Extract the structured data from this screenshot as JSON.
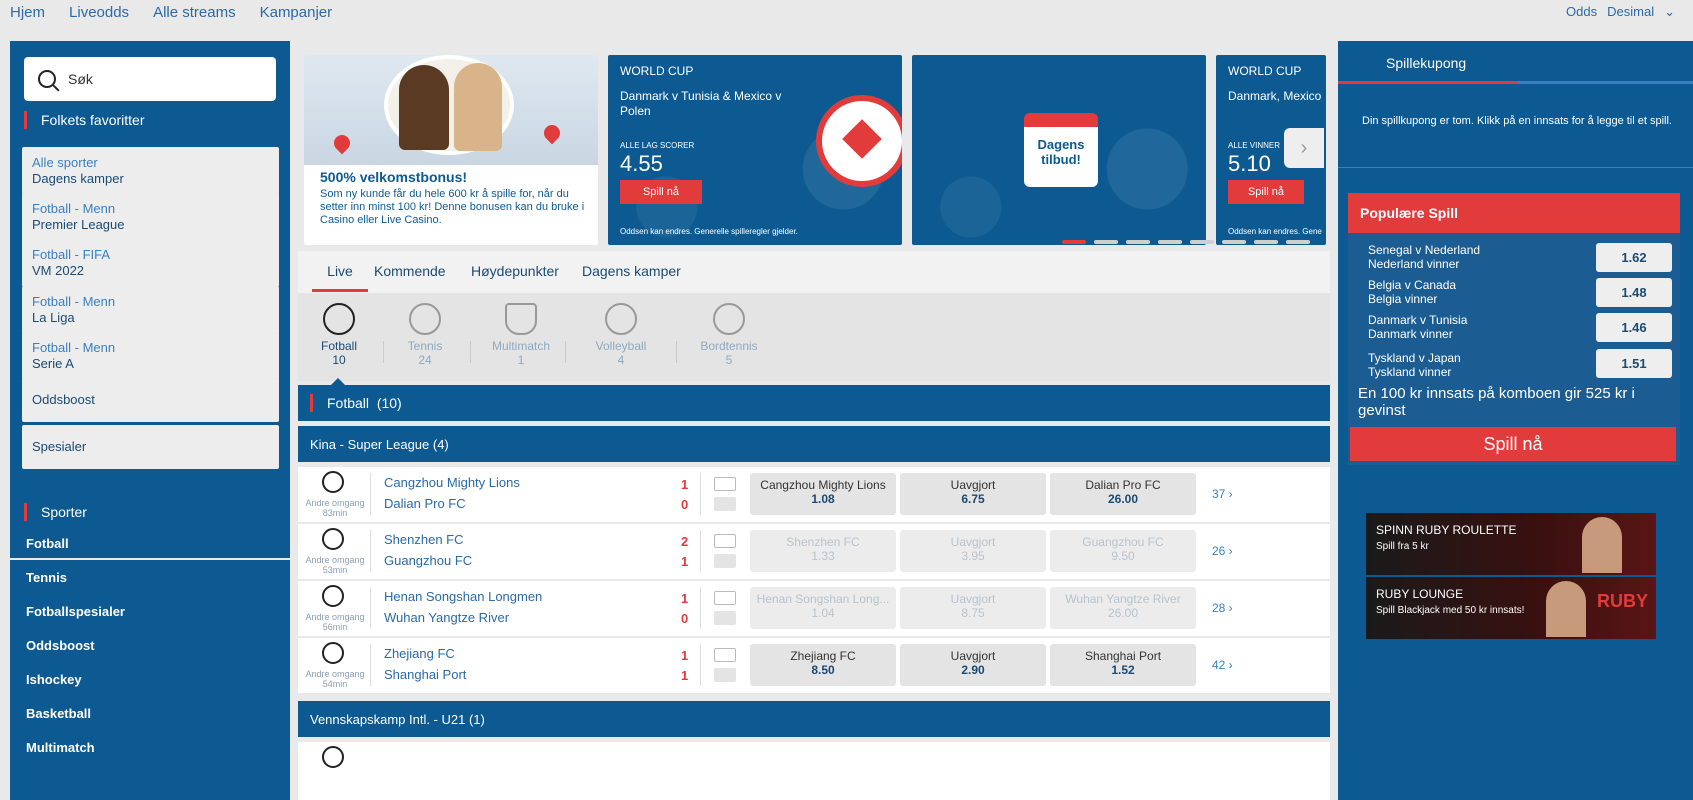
{
  "topnav": {
    "links": [
      "Hjem",
      "Liveodds",
      "Alle streams",
      "Kampanjer"
    ],
    "odds_label": "Odds",
    "odds_format": "Desimal"
  },
  "colors": {
    "brand": "#0d5a92",
    "accent": "#e23b3b"
  },
  "search": {
    "placeholder": "Søk"
  },
  "favorites": {
    "title": "Folkets favoritter",
    "items": [
      {
        "a": "Alle sporter",
        "b": "Dagens kamper"
      },
      {
        "a": "Fotball - Menn",
        "b": "Premier League"
      },
      {
        "a": "Fotball - FIFA",
        "b": "VM 2022"
      },
      {
        "a": "Fotball - Menn",
        "b": "La Liga"
      },
      {
        "a": "Fotball - Menn",
        "b": "Serie A"
      }
    ],
    "singles": [
      "Oddsboost",
      "Spesialer"
    ]
  },
  "sports": {
    "title": "Sporter",
    "items": [
      "Fotball",
      "Tennis",
      "Fotballspesialer",
      "Oddsboost",
      "Ishockey",
      "Basketball",
      "Multimatch"
    ]
  },
  "banners": {
    "b1": {
      "title": "500% velkomstbonus!",
      "text": "Som ny kunde får du hele 600 kr å spille for, når du setter inn minst 100 kr! Denne bonusen kan du bruke i Casino eller Live Casino."
    },
    "b2": {
      "tag": "WORLD CUP",
      "match": "Danmark v Tunisia & Mexico v Polen",
      "market": "ALLE LAG SCORER",
      "odd": "4.55",
      "cta": "Spill nå",
      "fine": "Oddsen kan endres. Generelle spilleregler gjelder."
    },
    "b3": {
      "line1": "Dagens",
      "line2": "tilbud!"
    },
    "b4": {
      "tag": "WORLD CUP",
      "match": "Danmark, Mexico",
      "market": "ALLE VINNER",
      "odd": "5.10",
      "cta": "Spill nå",
      "fine": "Oddsen kan endres. Gene"
    }
  },
  "tabs": [
    "Live",
    "Kommende",
    "Høydepunkter",
    "Dagens kamper"
  ],
  "sport_filters": [
    {
      "name": "Fotball",
      "count": "10"
    },
    {
      "name": "Tennis",
      "count": "24"
    },
    {
      "name": "Multimatch",
      "count": "1"
    },
    {
      "name": "Volleyball",
      "count": "4"
    },
    {
      "name": "Bordtennis",
      "count": "5"
    }
  ],
  "main_section": {
    "title": "Fotball",
    "count": "(10)"
  },
  "leagues": [
    {
      "title": "Kina - Super League (4)"
    },
    {
      "title": "Vennskapskamp Intl. - U21 (1)"
    }
  ],
  "matches": [
    {
      "status": "Andre omgang",
      "time": "83min",
      "home": "Cangzhou Mighty Lions",
      "away": "Dalian Pro FC",
      "hs": "1",
      "as": "0",
      "o1l": "Cangzhou Mighty Lions",
      "o1": "1.08",
      "oxl": "Uavgjort",
      "ox": "6.75",
      "o2l": "Dalian Pro FC",
      "o2": "26.00",
      "more": "37 ›"
    },
    {
      "status": "Andre omgang",
      "time": "53min",
      "home": "Shenzhen FC",
      "away": "Guangzhou FC",
      "hs": "2",
      "as": "1",
      "o1l": "Shenzhen FC",
      "o1": "1.33",
      "oxl": "Uavgjort",
      "ox": "3.95",
      "o2l": "Guangzhou FC",
      "o2": "9.50",
      "more": "26 ›"
    },
    {
      "status": "Andre omgang",
      "time": "56min",
      "home": "Henan Songshan Longmen",
      "away": "Wuhan Yangtze River",
      "hs": "1",
      "as": "0",
      "o1l": "Henan Songshan Long...",
      "o1": "1.04",
      "oxl": "Uavgjort",
      "ox": "8.75",
      "o2l": "Wuhan Yangtze River",
      "o2": "26.00",
      "more": "28 ›"
    },
    {
      "status": "Andre omgang",
      "time": "54min",
      "home": "Zhejiang FC",
      "away": "Shanghai Port",
      "hs": "1",
      "as": "1",
      "o1l": "Zhejiang FC",
      "o1": "8.50",
      "oxl": "Uavgjort",
      "ox": "2.90",
      "o2l": "Shanghai Port",
      "o2": "1.52",
      "more": "42 ›"
    }
  ],
  "slip": {
    "title": "Spillekupong",
    "empty": "Din spillkupong er tom. Klikk på en innsats for å legge til et spill."
  },
  "popular": {
    "title": "Populære Spill",
    "items": [
      {
        "match": "Senegal v Nederland",
        "sel": "Nederland vinner",
        "odd": "1.62"
      },
      {
        "match": "Belgia v Canada",
        "sel": "Belgia vinner",
        "odd": "1.48"
      },
      {
        "match": "Danmark v Tunisia",
        "sel": "Danmark vinner",
        "odd": "1.46"
      },
      {
        "match": "Tyskland v Japan",
        "sel": "Tyskland vinner",
        "odd": "1.51"
      }
    ],
    "note": "En 100 kr innsats på komboen gir 525 kr i gevinst",
    "cta": "Spill nå"
  },
  "promos": [
    {
      "title": "SPINN RUBY ROULETTE",
      "sub": "Spill fra 5 kr",
      "logo": ""
    },
    {
      "title": "RUBY LOUNGE",
      "sub": "Spill Blackjack med 50 kr innsats!",
      "logo": "RUBY"
    }
  ]
}
